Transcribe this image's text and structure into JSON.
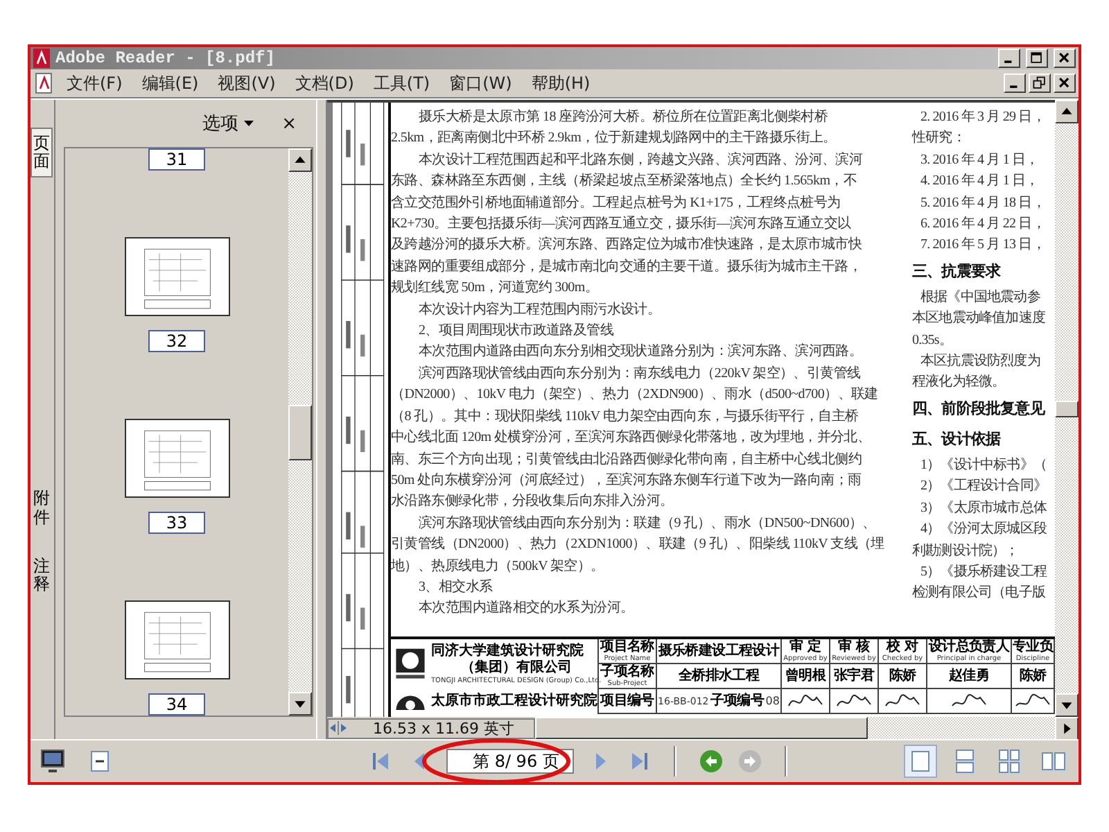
{
  "window": {
    "title": "Adobe Reader - [8.pdf]"
  },
  "menu": [
    {
      "label": "文件(F)"
    },
    {
      "label": "编辑(E)"
    },
    {
      "label": "视图(V)"
    },
    {
      "label": "文档(D)"
    },
    {
      "label": "工具(T)"
    },
    {
      "label": "窗口(W)"
    },
    {
      "label": "帮助(H)"
    }
  ],
  "nav_tabs": [
    {
      "label": "页面",
      "selected": true
    },
    {
      "label": "附件",
      "selected": false
    },
    {
      "label": "注释",
      "selected": false
    }
  ],
  "panel": {
    "options": "选项",
    "close": "×"
  },
  "thumbnails": [
    {
      "label": "31",
      "kind": "label"
    },
    {
      "label": "32",
      "kind": "page"
    },
    {
      "label": "33",
      "kind": "page"
    },
    {
      "label": "34",
      "kind": "page"
    }
  ],
  "document": {
    "left_lines": [
      {
        "text": "摄乐大桥是太原市第 18 座跨汾河大桥。桥位所在位置距离北侧柴村桥",
        "indent": true
      },
      {
        "text": "2.5km，距离南侧北中环桥 2.9km，位于新建规划路网中的主干路摄乐街上。",
        "indent": false
      },
      {
        "text": "本次设计工程范围西起和平北路东侧，跨越文兴路、滨河西路、汾河、滨河",
        "indent": true
      },
      {
        "text": "东路、森林路至东西侧，主线（桥梁起坡点至桥梁落地点）全长约 1.565km，不",
        "indent": false
      },
      {
        "text": "含立交范围外引桥地面辅道部分。工程起点桩号为 K1+175，工程终点桩号为",
        "indent": false
      },
      {
        "text": "K2+730。主要包括摄乐街—滨河西路互通立交，摄乐街—滨河东路互通立交以",
        "indent": false
      },
      {
        "text": "及跨越汾河的摄乐大桥。滨河东路、西路定位为城市准快速路，是太原市城市快",
        "indent": false
      },
      {
        "text": "速路网的重要组成部分，是城市南北向交通的主要干道。摄乐街为城市主干路，",
        "indent": false
      },
      {
        "text": "规划红线宽 50m，河道宽约 300m。",
        "indent": false
      },
      {
        "text": "本次设计内容为工程范围内雨污水设计。",
        "indent": true
      },
      {
        "text": "2、项目周围现状市政道路及管线",
        "indent": true
      },
      {
        "text": "本次范围内道路由西向东分别相交现状道路分别为：滨河东路、滨河西路。",
        "indent": true
      },
      {
        "text": "滨河西路现状管线由西向东分别为：南东线电力（220kV 架空）、引黄管线",
        "indent": true
      },
      {
        "text": "（DN2000）、10kV 电力（架空）、热力（2XDN900）、雨水（d500~d700）、联建",
        "indent": false
      },
      {
        "text": "（8 孔）。其中：现状阳柴线 110kV 电力架空由西向东，与摄乐街平行，自主桥",
        "indent": false
      },
      {
        "text": "中心线北面 120m 处横穿汾河，至滨河东路西侧绿化带落地，改为埋地，并分北、",
        "indent": false
      },
      {
        "text": "南、东三个方向出现；引黄管线由北沿路西侧绿化带向南，自主桥中心线北侧约",
        "indent": false
      },
      {
        "text": "50m 处向东横穿汾河（河底经过），至滨河东路东侧车行道下改为一路向南；雨",
        "indent": false
      },
      {
        "text": "水沿路东侧绿化带，分段收集后向东排入汾河。",
        "indent": false
      },
      {
        "text": "滨河东路现状管线由西向东分别为：联建（9 孔）、雨水（DN500~DN600）、",
        "indent": true
      },
      {
        "text": "引黄管线（DN2000）、热力（2XDN1000）、联建（9 孔）、阳柴线 110kV 支线（埋",
        "indent": false
      },
      {
        "text": "地）、热原线电力（500kV 架空）。",
        "indent": false
      },
      {
        "text": "3、相交水系",
        "indent": true
      },
      {
        "text": "本次范围内道路相交的水系为汾河。",
        "indent": true
      }
    ],
    "right_lines": [
      {
        "text": "2. 2016 年 3 月 29 日，",
        "kind": "item"
      },
      {
        "text": "性研究：",
        "kind": "plain"
      },
      {
        "text": "3. 2016 年 4 月 1 日，",
        "kind": "item"
      },
      {
        "text": "4. 2016 年 4 月 1 日，",
        "kind": "item"
      },
      {
        "text": "5. 2016 年 4 月 18 日，",
        "kind": "item"
      },
      {
        "text": "6. 2016 年 4 月 22 日，",
        "kind": "item"
      },
      {
        "text": "7. 2016 年 5 月 13 日，",
        "kind": "item"
      },
      {
        "text": "三、抗震要求",
        "kind": "heading"
      },
      {
        "text": "根据《中国地震动参",
        "kind": "item"
      },
      {
        "text": "本区地震动峰值加速度",
        "kind": "plain"
      },
      {
        "text": "0.35s。",
        "kind": "plain"
      },
      {
        "text": "本区抗震设防烈度为",
        "kind": "item"
      },
      {
        "text": "程液化为轻微。",
        "kind": "plain"
      },
      {
        "text": "四、前阶段批复意见",
        "kind": "heading"
      },
      {
        "text": "五、设计依据",
        "kind": "heading"
      },
      {
        "text": "1）《设计中标书》（",
        "kind": "item"
      },
      {
        "text": "2）《工程设计合同》",
        "kind": "item"
      },
      {
        "text": "3）《太原市城市总体",
        "kind": "item"
      },
      {
        "text": "4）《汾河太原城区段",
        "kind": "item"
      },
      {
        "text": "利勘测设计院）；",
        "kind": "plain"
      },
      {
        "text": "5）《摄乐桥建设工程",
        "kind": "item"
      },
      {
        "text": "检测有限公司（电子版",
        "kind": "plain"
      }
    ],
    "title_block": {
      "institute_1": {
        "name": "同济大学建筑设计研究院",
        "sub": "（集团）有限公司",
        "english": "TONGJI ARCHITECTURAL DESIGN (Group) Co.,Ltd."
      },
      "institute_2": {
        "name": "太原市市政工程设计研究院"
      },
      "project_name": {
        "label": "项目名称",
        "english": "Project Name",
        "value": "摄乐桥建设工程设计"
      },
      "sub_project": {
        "label": "子项名称",
        "english": "Sub-Project",
        "value": "全桥排水工程"
      },
      "project_no": {
        "label": "项目编号",
        "value": "16-BB-012",
        "sub_label": "子项编号",
        "sub_value": "08"
      },
      "roles": [
        {
          "label": "审 定",
          "english": "Approved by",
          "name": "曾明根"
        },
        {
          "label": "审 核",
          "english": "Reviewed by",
          "name": "张宇君"
        },
        {
          "label": "校 对",
          "english": "Checked by",
          "name": "陈娇"
        },
        {
          "label": "设计总负责人",
          "english": "Principal in charge",
          "name": "赵佳勇"
        },
        {
          "label": "专业负",
          "english": "Discipline",
          "name": "陈娇"
        }
      ]
    }
  },
  "page_size": "16.53 x 11.69 英寸",
  "toolbar": {
    "page_field": "第 8/ 96 页",
    "back_enabled": true,
    "forward_enabled": false,
    "views": [
      {
        "kind": "single",
        "selected": true
      },
      {
        "kind": "continuous",
        "selected": false
      },
      {
        "kind": "grid",
        "selected": false
      },
      {
        "kind": "facing",
        "selected": false
      }
    ]
  }
}
